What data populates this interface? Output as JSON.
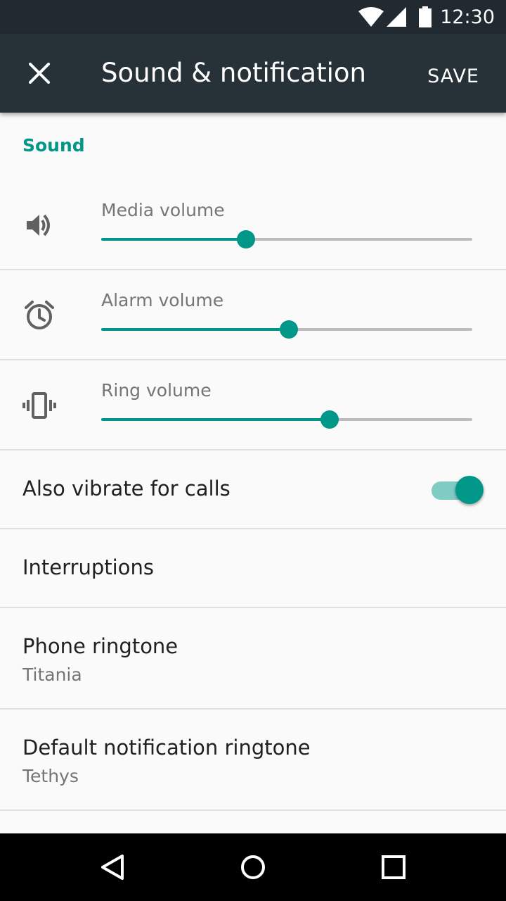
{
  "status_bar": {
    "time": "12:30",
    "icons": [
      "wifi-icon",
      "cell-signal-icon",
      "battery-icon"
    ],
    "color": "#202a30"
  },
  "app_bar": {
    "title": "Sound & notification",
    "save_label": "SAVE",
    "close_icon": "close-icon",
    "color": "#263238"
  },
  "section": {
    "header": "Sound",
    "accent_color": "#009688"
  },
  "sliders": [
    {
      "label": "Media volume",
      "icon": "speaker-icon",
      "value": 0.39
    },
    {
      "label": "Alarm volume",
      "icon": "alarm-clock-icon",
      "value": 0.505
    },
    {
      "label": "Ring volume",
      "icon": "vibrate-icon",
      "value": 0.615
    }
  ],
  "vibrate": {
    "label": "Also vibrate for calls",
    "checked": true
  },
  "interruptions": {
    "label": "Interruptions"
  },
  "phone_ringtone": {
    "label": "Phone ringtone",
    "value": "Titania"
  },
  "notification_ringtone": {
    "label": "Default notification ringtone",
    "value": "Tethys"
  },
  "nav_bar": {
    "icons": [
      "back-icon",
      "home-icon",
      "recents-icon"
    ]
  }
}
